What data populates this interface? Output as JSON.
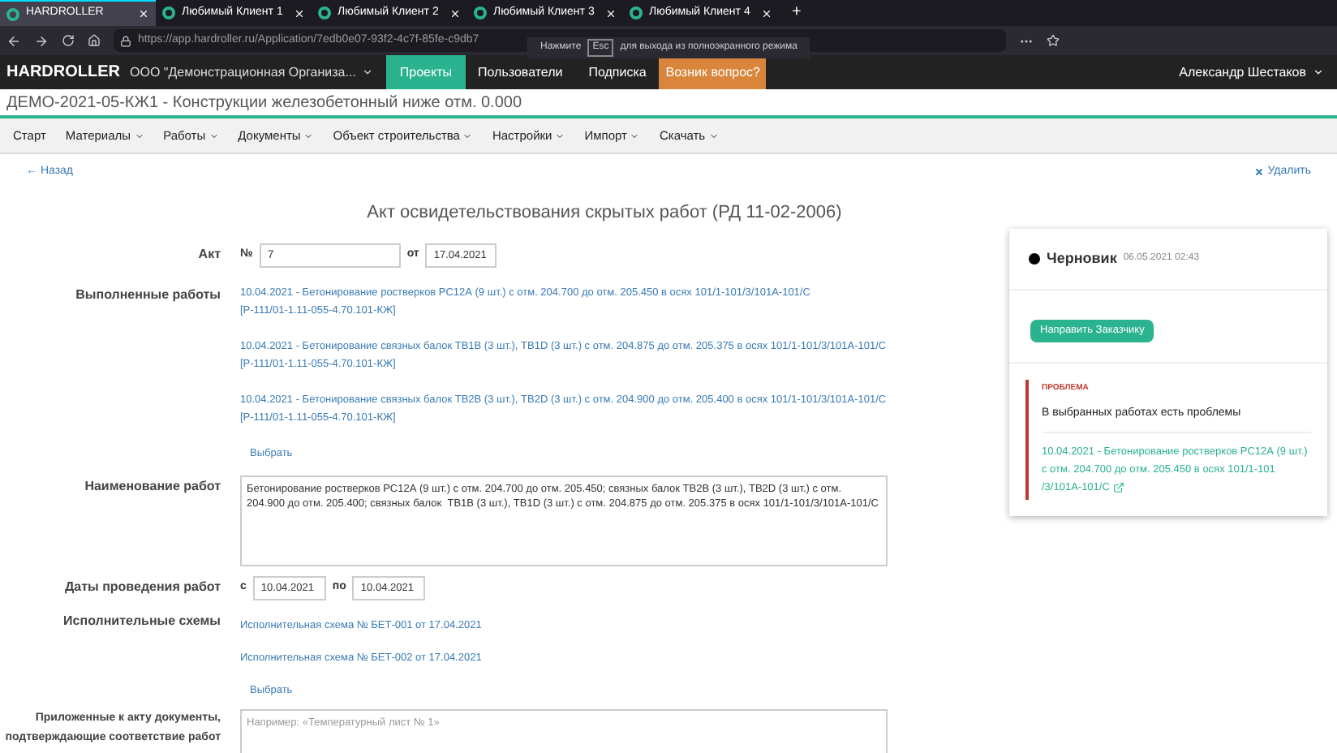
{
  "browser": {
    "tabs": [
      {
        "label": "HARDROLLER",
        "selected": true
      },
      {
        "label": "Любимый Клиент 1",
        "selected": false
      },
      {
        "label": "Любимый Клиент 2",
        "selected": false
      },
      {
        "label": "Любимый Клиент 3",
        "selected": false
      },
      {
        "label": "Любимый Клиент 4",
        "selected": false
      }
    ],
    "new_tab": "+",
    "url": "https://app.hardroller.ru/Application/7edb0e07-93f2-4c7f-85fe-c9db7",
    "fullscreen_notice": {
      "before": "Нажмите",
      "key": "Esc",
      "after": "для выхода из полноэкранного режима"
    }
  },
  "header": {
    "logo": "HARDROLLER",
    "org": "ООО \"Демонстрационная Организа...",
    "menu": [
      {
        "label": "Проекты",
        "selected": true,
        "kind": "tab"
      },
      {
        "label": "Пользователи",
        "selected": false,
        "kind": "tab"
      },
      {
        "label": "Подписка",
        "selected": false,
        "kind": "tab"
      },
      {
        "label": "Возник вопрос?",
        "selected": false,
        "kind": "help"
      }
    ],
    "user": "Александр Шестаков"
  },
  "project_title": "ДЕМО-2021-05-КЖ1 - Конструкции железобетонный ниже отм. 0.000",
  "nav": [
    {
      "label": "Старт",
      "dropdown": false
    },
    {
      "label": "Материалы",
      "dropdown": true
    },
    {
      "label": "Работы",
      "dropdown": true
    },
    {
      "label": "Документы",
      "dropdown": true
    },
    {
      "label": "Объект строительства",
      "dropdown": true
    },
    {
      "label": "Настройки",
      "dropdown": true
    },
    {
      "label": "Импорт",
      "dropdown": true
    },
    {
      "label": "Скачать",
      "dropdown": true
    }
  ],
  "back": "← Назад",
  "delete": "Удалить",
  "form": {
    "title": "Акт освидетельствования скрытых работ (РД 11-02-2006)",
    "act": {
      "label": "Акт",
      "number_label": "№",
      "number": "7",
      "date_label": "от",
      "date": "17.04.2021"
    },
    "works": {
      "label": "Выполненные работы",
      "items": [
        {
          "text": "10.04.2021 - Бетонирование ростверков РС12А (9 шт.) с отм. 204.700 до отм. 205.450 в осях 101/1-101/3/101А-101/С",
          "code": "[Р-111/01-1.11-055-4.70.101-КЖ]"
        },
        {
          "text": "10.04.2021 - Бетонирование связных балок ТВ1В (3 шт.), ТВ1D (3 шт.) с отм. 204.875 до отм. 205.375 в осях 101/1-101/3/101А-101/С",
          "code": "[Р-111/01-1.11-055-4.70.101-КЖ]"
        },
        {
          "text": "10.04.2021 - Бетонирование связных балок ТВ2В (3 шт.), ТВ2D (3 шт.) с отм. 204.900 до отм. 205.400 в осях 101/1-101/3/101А-101/С",
          "code": "[Р-111/01-1.11-055-4.70.101-КЖ]"
        }
      ],
      "select": "Выбрать"
    },
    "name": {
      "label": "Наименование работ",
      "value": "Бетонирование ростверков РС12А (9 шт.) с отм. 204.700 до отм. 205.450; связных балок ТВ2В (3 шт.), ТВ2D (3 шт.) с отм. 204.900 до отм. 205.400; связных балок  ТВ1В (3 шт.), ТВ1D (3 шт.) с отм. 204.875 до отм. 205.375 в осях 101/1-101/3/101А-101/С"
    },
    "dates": {
      "label": "Даты проведения работ",
      "from_label": "с",
      "from": "10.04.2021",
      "to_label": "по",
      "to": "10.04.2021"
    },
    "schemes": {
      "label": "Исполнительные схемы",
      "items": [
        "Исполнительная схема № БЕТ-001 от 17.04.2021",
        "Исполнительная схема № БЕТ-002 от 17.04.2021"
      ],
      "select": "Выбрать"
    },
    "attachments": {
      "label": "Приложенные к акту документы, подтверждающие соответствие работ",
      "placeholder": "Например: «Температурный лист № 1»"
    }
  },
  "status_card": {
    "status": "Черновик",
    "date": "06.05.2021 02:43",
    "button": "Направить Заказчику",
    "problem": {
      "title": "ПРОБЛЕМА",
      "text": "В выбранных работах есть проблемы",
      "link": "10.04.2021 - Бетонирование ростверков РС12А (9 шт.) с отм. 204.700 до отм. 205.450 в осях 101/1-101 /3/101А-101/С"
    }
  }
}
